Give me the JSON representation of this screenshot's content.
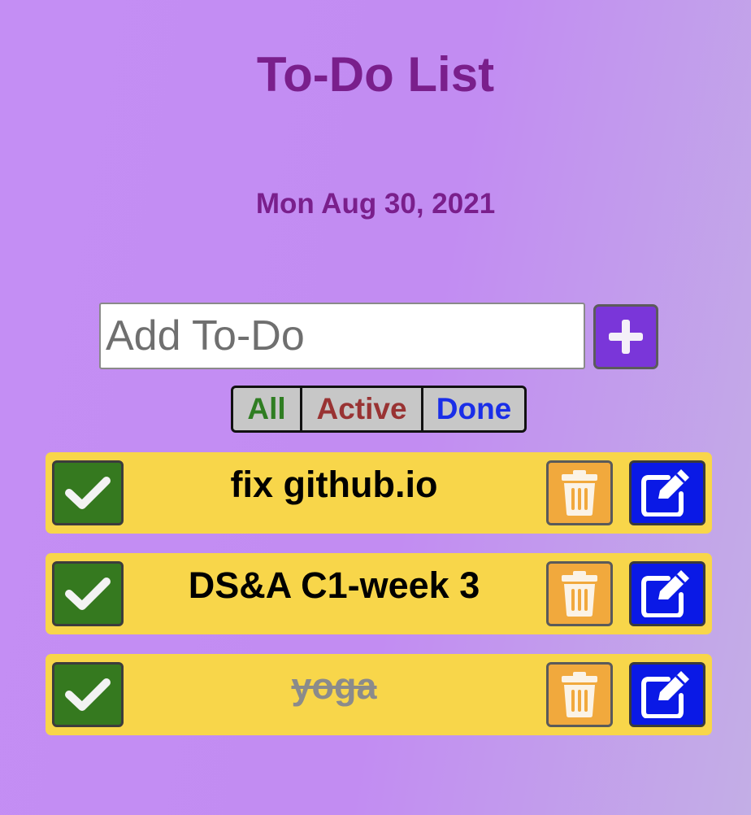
{
  "header": {
    "title": "To-Do List",
    "date": "Mon Aug 30, 2021"
  },
  "add_form": {
    "placeholder": "Add To-Do",
    "value": "",
    "button_icon": "plus-icon"
  },
  "filters": [
    {
      "label": "All",
      "color": "#2f7d22"
    },
    {
      "label": "Active",
      "color": "#993333"
    },
    {
      "label": "Done",
      "color": "#1a2ee8"
    }
  ],
  "todos": [
    {
      "text": "fix github.io",
      "done": false
    },
    {
      "text": "DS&A C1-week 3",
      "done": false
    },
    {
      "text": "yoga",
      "done": true
    }
  ],
  "icons": {
    "complete": "check-icon",
    "delete": "trash-icon",
    "edit": "edit-icon"
  },
  "colors": {
    "title": "#7a1f8c",
    "item_background": "#f8d64a",
    "complete_button": "#35791f",
    "delete_button": "#f1a93d",
    "edit_button": "#0a19e6",
    "add_button": "#7a36d9"
  }
}
